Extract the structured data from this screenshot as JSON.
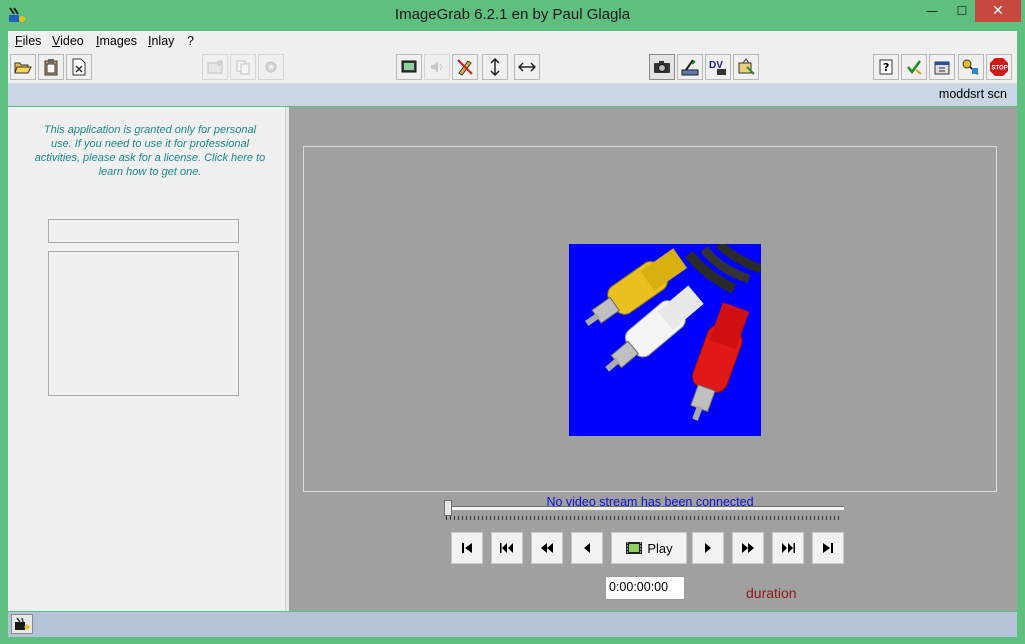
{
  "window": {
    "title": "ImageGrab 6.2.1 en by Paul Glagla",
    "minimize_glyph": "—",
    "maximize_glyph": "☐",
    "close_glyph": "✕"
  },
  "menu": {
    "items": [
      {
        "label": "Files",
        "key": "F"
      },
      {
        "label": "Video",
        "key": "V"
      },
      {
        "label": "Images",
        "key": "I"
      },
      {
        "label": "Inlay",
        "key": "I"
      },
      {
        "label": "?",
        "key": ""
      }
    ]
  },
  "toolbar": {
    "buttons": [
      {
        "icon": "open-folder-icon"
      },
      {
        "icon": "clipboard-icon"
      },
      {
        "icon": "close-file-icon"
      },
      {
        "icon": "save-image-icon",
        "disabled": true
      },
      {
        "icon": "copy-icon",
        "disabled": true
      },
      {
        "icon": "settings-gear-icon",
        "disabled": true
      },
      {
        "icon": "screen-icon"
      },
      {
        "icon": "speaker-icon",
        "disabled": true
      },
      {
        "icon": "crossed-pen-icon"
      },
      {
        "icon": "vertical-resize-icon"
      },
      {
        "icon": "horizontal-resize-icon"
      },
      {
        "icon": "camera-icon",
        "pressed": true
      },
      {
        "icon": "scan-icon"
      },
      {
        "icon": "dv-icon"
      },
      {
        "icon": "tv-source-icon"
      },
      {
        "icon": "help-icon"
      },
      {
        "icon": "checkmark-icon"
      },
      {
        "icon": "preferences-icon"
      },
      {
        "icon": "keys-icon"
      },
      {
        "icon": "stop-icon"
      }
    ],
    "stop_label": "STOP",
    "dv_label": "DV"
  },
  "status_strip": {
    "mode_text": "moddsrt scn"
  },
  "left_panel": {
    "license_text": "This application is granted only for  personal use. If you need to use it for professional activities, please ask for a license. Click here to learn how to get one."
  },
  "video": {
    "message": "No video stream has been connected",
    "position_fraction": 0
  },
  "playback": {
    "buttons": [
      {
        "name": "go-to-start",
        "glyph": "⏮"
      },
      {
        "name": "fast-rewind",
        "glyph": "⏪"
      },
      {
        "name": "rewind",
        "glyph": "◀◀"
      },
      {
        "name": "step-back",
        "glyph": "◀"
      },
      {
        "name": "play",
        "glyph": "Play"
      },
      {
        "name": "step-forward",
        "glyph": "▶"
      },
      {
        "name": "forward",
        "glyph": "▶▶"
      },
      {
        "name": "fast-forward",
        "glyph": "⏩"
      },
      {
        "name": "go-to-end",
        "glyph": "⏭"
      }
    ],
    "time_value": "0:00:00:00",
    "duration_label": "duration"
  },
  "colors": {
    "title_bar": "#5fbf7e",
    "video_area": "#a0a0a0",
    "message": "#1010d8",
    "license": "#1a8a8a",
    "duration": "#8b1a1a",
    "image_background": "#0000ff"
  }
}
